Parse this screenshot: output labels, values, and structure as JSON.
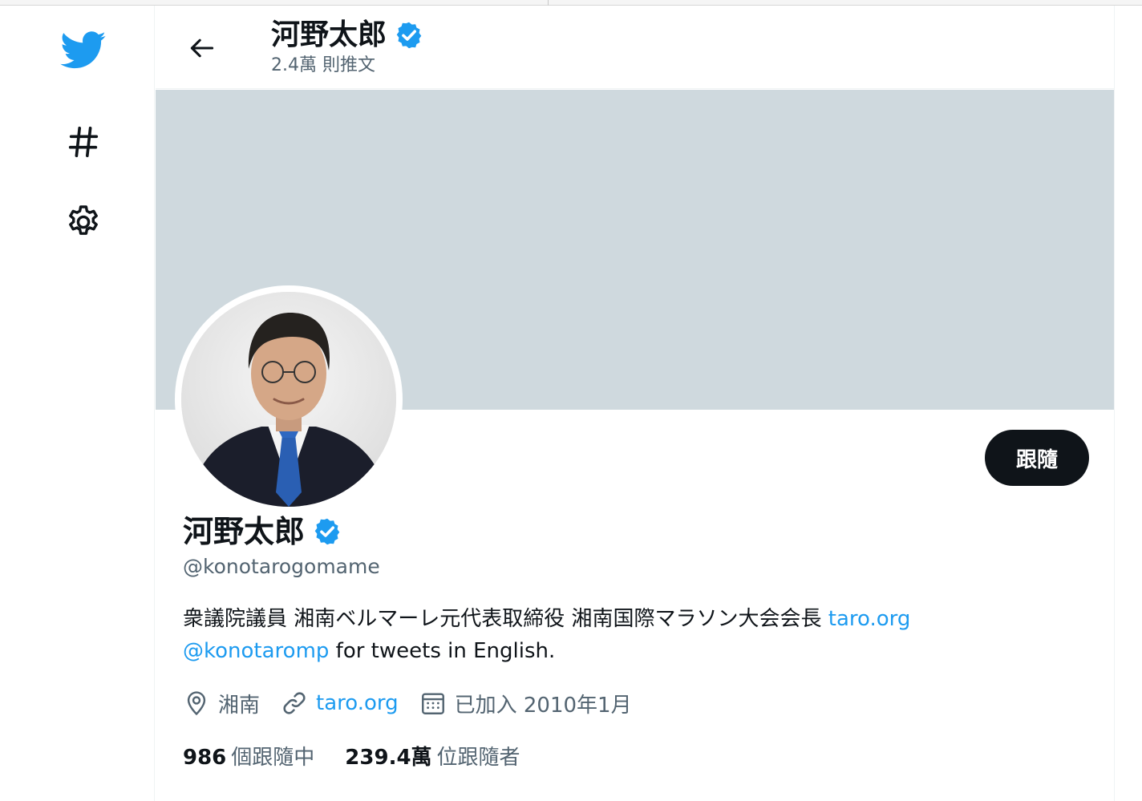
{
  "colors": {
    "accent": "#1d9bf0",
    "verified": "#1d9bf0",
    "text_primary": "#0f1419",
    "text_secondary": "#536471",
    "banner": "#cfd9de",
    "follow_button_bg": "#0f1419"
  },
  "nav": {
    "logo_icon": "twitter-bird-icon",
    "explore_icon": "hashtag-icon",
    "settings_icon": "gear-icon"
  },
  "header": {
    "name": "河野太郎",
    "tweet_count": "2.4萬 則推文",
    "back_icon": "arrow-left-icon"
  },
  "profile": {
    "name": "河野太郎",
    "handle": "@konotarogomame",
    "follow_label": "跟隨",
    "bio": {
      "text": "衆議院議員 湘南ベルマーレ元代表取締役 湘南国際マラソン大会会長 ",
      "link1": "taro.org",
      "mention": "@konotaromp",
      "text2": " for tweets in English."
    },
    "meta": {
      "location": "湘南",
      "website": "taro.org",
      "joined": "已加入 2010年1月"
    },
    "stats": {
      "following_count": "986",
      "following_label": "個跟隨中",
      "followers_count": "239.4萬",
      "followers_label": "位跟隨者"
    }
  }
}
